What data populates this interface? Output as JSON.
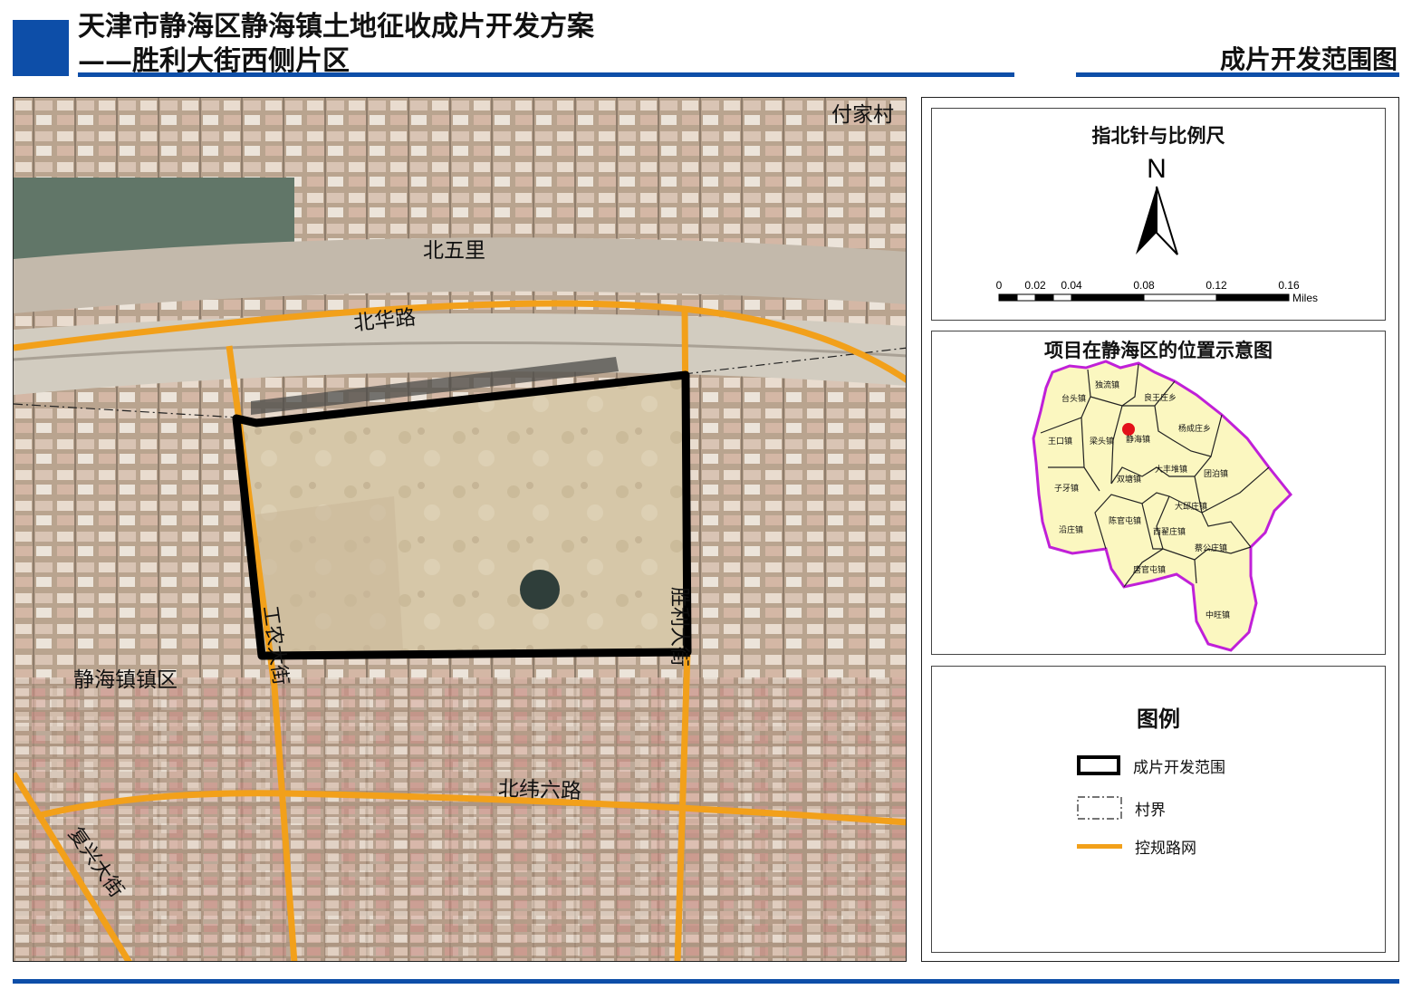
{
  "header": {
    "title_line1": "天津市静海区静海镇土地征收成片开发方案",
    "title_line2": "——胜利大街西侧片区",
    "map_kind": "成片开发范围图"
  },
  "colors": {
    "brand_blue": "#0d4ea8",
    "road_orange": "#f2a01a",
    "boundary_black": "#000000",
    "district_fill": "#fbf7c0",
    "district_outline": "#c020d8",
    "marker_red": "#e3101a"
  },
  "main_map": {
    "labels": {
      "fujia_village": "付家村",
      "beiwuli": "北五里",
      "beihua_road": "北华路",
      "jinghai_town_area": "静海镇镇区",
      "gongnong_street": "工农大街",
      "shengli_street": "胜利大街",
      "beiwei6_road": "北纬六路",
      "fuxing_street": "复兴大街"
    }
  },
  "compass": {
    "title": "指北针与比例尺",
    "north_letter": "N",
    "scale_ticks": [
      "0",
      "0.02",
      "0.04",
      "0.08",
      "0.12",
      "0.16"
    ],
    "scale_unit": "Miles"
  },
  "location_map": {
    "title": "项目在静海区的位置示意图",
    "towns": [
      "台头镇",
      "独流镇",
      "良王庄乡",
      "杨成庄乡",
      "王口镇",
      "梁头镇",
      "静海镇",
      "团泊镇",
      "双塘镇",
      "大丰堆镇",
      "子牙镇",
      "大邱庄镇",
      "陈官屯镇",
      "沿庄镇",
      "西翟庄镇",
      "蔡公庄镇",
      "唐官屯镇",
      "中旺镇"
    ]
  },
  "legend": {
    "title": "图例",
    "items": [
      {
        "label": "成片开发范围",
        "symbol": "boundary-box"
      },
      {
        "label": "村界",
        "symbol": "dash-dot-box"
      },
      {
        "label": "控规路网",
        "symbol": "orange-line"
      }
    ]
  }
}
